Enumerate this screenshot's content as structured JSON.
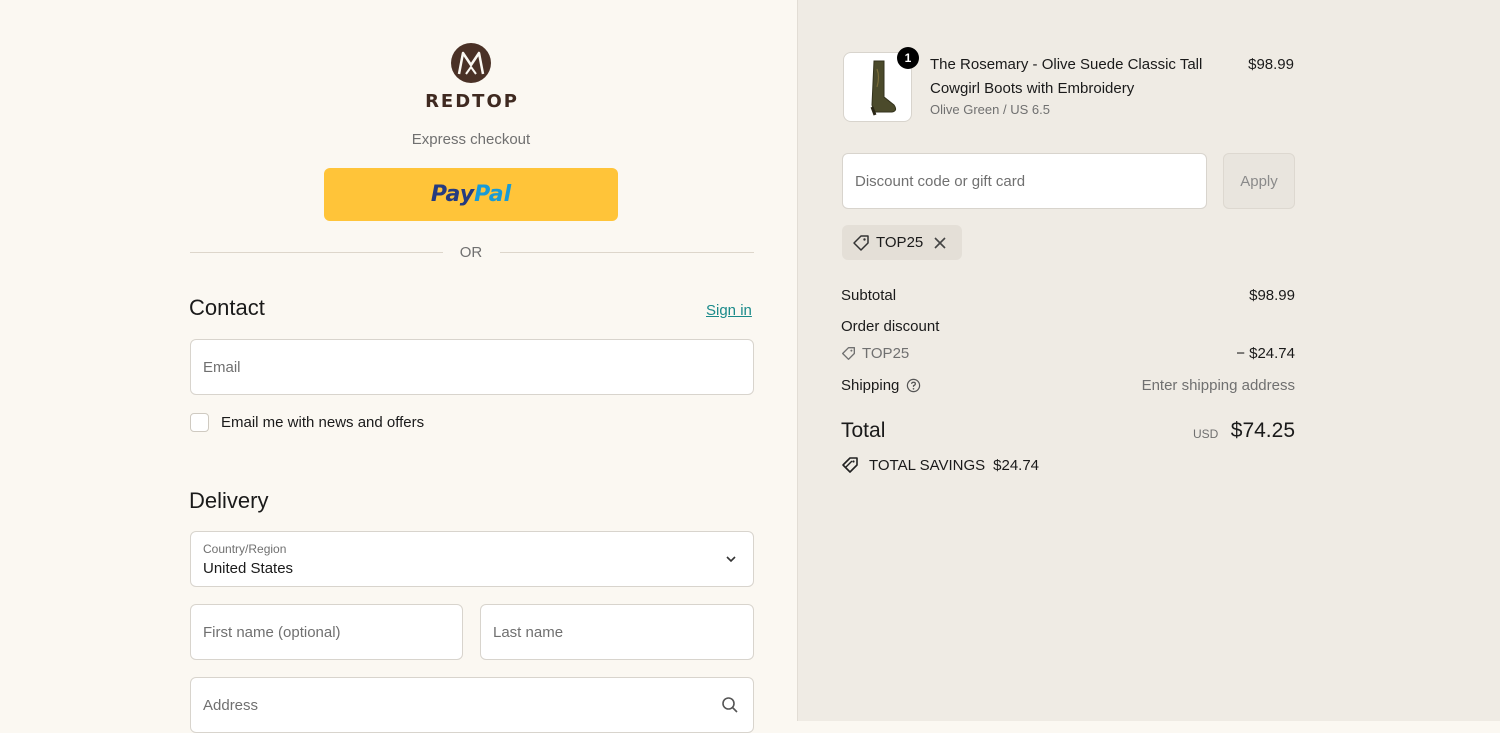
{
  "brand": {
    "name": "REDTOP",
    "logo_letter": "M"
  },
  "express": {
    "label": "Express checkout",
    "paypal_part1": "Pay",
    "paypal_part2": "Pal"
  },
  "divider": {
    "text": "OR"
  },
  "contact": {
    "heading": "Contact",
    "signin": "Sign in",
    "email_placeholder": "Email",
    "newsletter_label": "Email me with news and offers"
  },
  "delivery": {
    "heading": "Delivery",
    "country_label": "Country/Region",
    "country_value": "United States",
    "first_name_placeholder": "First name (optional)",
    "last_name_placeholder": "Last name",
    "address_placeholder": "Address"
  },
  "product": {
    "quantity": "1",
    "name": "The Rosemary - Olive Suede Classic Tall Cowgirl Boots with Embroidery",
    "variant": "Olive Green / US 6.5",
    "price": "$98.99"
  },
  "discount": {
    "placeholder": "Discount code or gift card",
    "apply": "Apply",
    "applied_code": "TOP25"
  },
  "summary": {
    "subtotal_label": "Subtotal",
    "subtotal_value": "$98.99",
    "order_discount_label": "Order discount",
    "discount_code": "TOP25",
    "discount_value": "− $24.74",
    "shipping_label": "Shipping",
    "shipping_value": "Enter shipping address",
    "total_label": "Total",
    "total_currency": "USD",
    "total_value": "$74.25",
    "savings_label": "TOTAL SAVINGS",
    "savings_value": "$24.74"
  },
  "colors": {
    "paypal": "#ffc439",
    "link": "#1a8a8a",
    "brand": "#4a3126"
  }
}
